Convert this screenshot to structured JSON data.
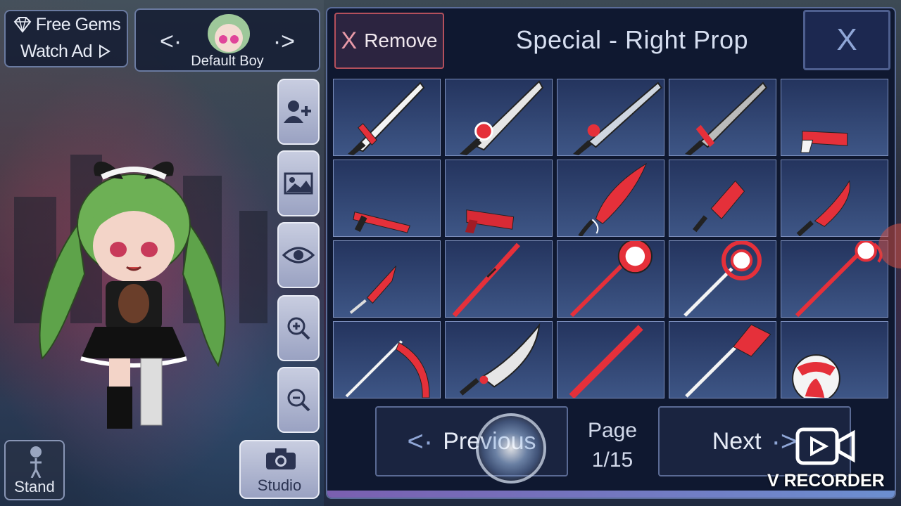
{
  "currency": {
    "label": "Free Gems",
    "action": "Watch Ad"
  },
  "character": {
    "name": "Default Boy"
  },
  "side_tools": [
    "add-character",
    "background",
    "visibility",
    "zoom-in",
    "zoom-out"
  ],
  "pose": {
    "label": "Stand"
  },
  "studio": {
    "label": "Studio"
  },
  "panel": {
    "remove_label": "Remove",
    "remove_glyph": "X",
    "title": "Special - Right Prop",
    "close_glyph": "X"
  },
  "props": [
    {
      "name": "sword-white"
    },
    {
      "name": "sword-ring-guard"
    },
    {
      "name": "sword-silver"
    },
    {
      "name": "sword-grey"
    },
    {
      "name": "pistol-red"
    },
    {
      "name": "shotgun-red"
    },
    {
      "name": "pistol-dark-red"
    },
    {
      "name": "cutlass-red"
    },
    {
      "name": "cleaver-red"
    },
    {
      "name": "knife-red"
    },
    {
      "name": "dagger-red"
    },
    {
      "name": "spear-red"
    },
    {
      "name": "staff-orb"
    },
    {
      "name": "staff-target"
    },
    {
      "name": "staff-crescent"
    },
    {
      "name": "scythe-red"
    },
    {
      "name": "machete-white"
    },
    {
      "name": "pole-red"
    },
    {
      "name": "shovel-red"
    },
    {
      "name": "beach-ball"
    }
  ],
  "pager": {
    "prev_label": "Previous",
    "next_label": "Next",
    "page_label": "Page",
    "page_value": "1/15"
  },
  "watermark": {
    "label": "V RECORDER"
  },
  "colors": {
    "accent": "#e5303a",
    "panel": "#0f1830",
    "tile": "#3e5686"
  }
}
